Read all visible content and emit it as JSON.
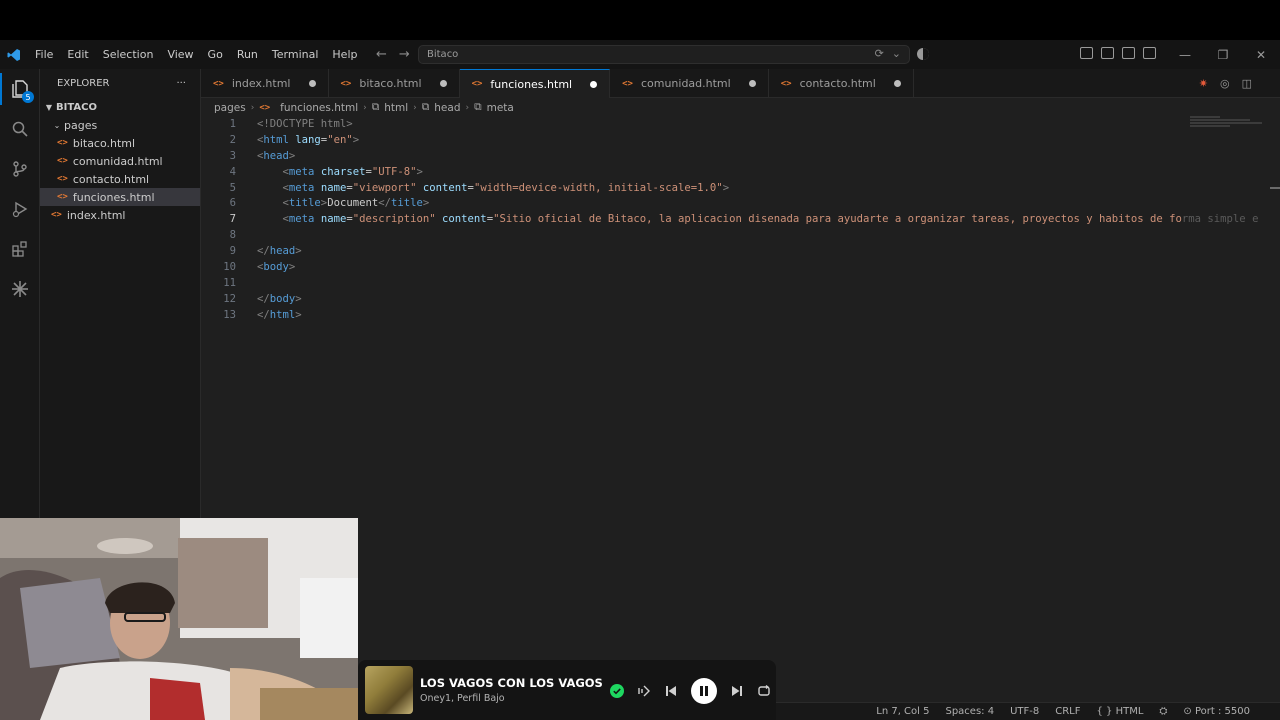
{
  "menu": [
    "File",
    "Edit",
    "Selection",
    "View",
    "Go",
    "Run",
    "Terminal",
    "Help"
  ],
  "search": {
    "text": "Bitaco"
  },
  "sidebar": {
    "title": "EXPLORER",
    "more": "···",
    "root": "BITACO",
    "folder": "pages",
    "items": [
      "bitaco.html",
      "comunidad.html",
      "contacto.html",
      "funciones.html"
    ],
    "root_file": "index.html",
    "badge": "5"
  },
  "tabs": [
    {
      "label": "index.html"
    },
    {
      "label": "bitaco.html"
    },
    {
      "label": "funciones.html"
    },
    {
      "label": "comunidad.html"
    },
    {
      "label": "contacto.html"
    }
  ],
  "breadcrumb": [
    "pages",
    "funciones.html",
    "html",
    "head",
    "meta"
  ],
  "code": {
    "line_numbers": [
      "1",
      "2",
      "3",
      "4",
      "5",
      "6",
      "7",
      "8",
      "9",
      "10",
      "11",
      "12",
      "13"
    ],
    "l1": "<!DOCTYPE html>",
    "l2a": "<",
    "l2b": "html",
    "l2c": " lang",
    "l2d": "=",
    "l2e": "\"en\"",
    "l2f": ">",
    "l4_attr": "charset",
    "l4_val": "\"UTF-8\"",
    "l5_attr1": "name",
    "l5_val1": "\"viewport\"",
    "l5_attr2": "content",
    "l5_val2": "\"width=device-width, initial-scale=1.0\"",
    "l6_text": "Document",
    "l7_attr1": "name",
    "l7_val1": "\"description\"",
    "l7_attr2": "content",
    "l7_val2": "\"Sitio oficial de Bitaco, la aplicacion disenada para ayudarte a organizar tareas, proyectos y habitos de fo",
    "l7_ghost": "rma simple e",
    "tag_html": "html",
    "tag_head": "head",
    "tag_meta": "meta",
    "tag_title": "title",
    "tag_body": "body"
  },
  "status": {
    "position": "Ln 7, Col 5",
    "spaces": "Spaces: 4",
    "encoding": "UTF-8",
    "eol": "CRLF",
    "language": "HTML",
    "port": "Port : 5500"
  },
  "player": {
    "title": "LOS VAGOS CON LOS VAGOS",
    "artist": "Oney1, Perfil Bajo"
  }
}
